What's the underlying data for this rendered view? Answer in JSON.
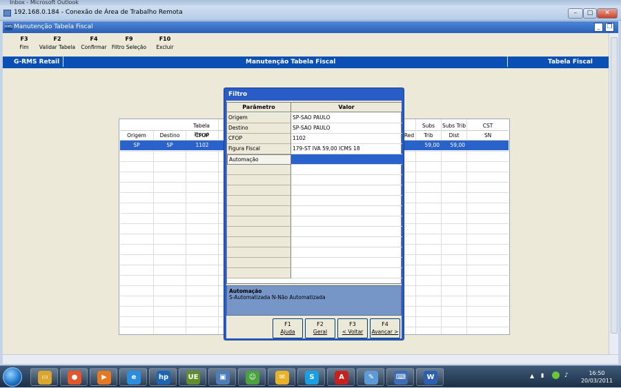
{
  "outlook_window": {
    "title": "Inbox - Microsoft Outlook"
  },
  "rdp_window": {
    "title": "192.168.0.184 - Conexão de Área de Trabalho Remota",
    "min": "–",
    "max": "□",
    "close": "✕"
  },
  "app_window": {
    "title": "Manutenção Tabela Fiscal",
    "icon_text": "RMS",
    "min": "_",
    "restore": "❐"
  },
  "function_keys": [
    {
      "key": "F3",
      "label": "Fim"
    },
    {
      "key": "F2",
      "label": "Validar Tabela"
    },
    {
      "key": "F4",
      "label": "Confirmar"
    },
    {
      "key": "F9",
      "label": "Filtro Seleção"
    },
    {
      "key": "F10",
      "label": "Excluir"
    }
  ],
  "header_bar": {
    "left": "G-RMS Retail",
    "center": "Manutenção Tabela Fiscal",
    "right": "Tabela Fiscal"
  },
  "background_grid": {
    "group_header": "Tabela Fiscal",
    "columns": [
      "Origem",
      "Destino",
      "CFOP"
    ],
    "right_columns": [
      {
        "top": "",
        "bottom": "Red"
      },
      {
        "top": "Subs",
        "bottom": "Trib"
      },
      {
        "top": "Subs Trib",
        "bottom": "Dist"
      },
      {
        "top": "CST",
        "bottom": "SN"
      }
    ],
    "selected_row": {
      "origem": "SP",
      "destino": "SP",
      "cfop": "1102",
      "subs_trib": "59,00",
      "subs_trib_dist": "59,00"
    }
  },
  "filter_dialog": {
    "title": "Filtro",
    "headers": {
      "param": "Parâmetro",
      "value": "Valor"
    },
    "rows": [
      {
        "param": "Origem",
        "value": "SP-SAO PAULO"
      },
      {
        "param": "Destino",
        "value": "SP-SAO PAULO"
      },
      {
        "param": "CFOP",
        "value": "1102"
      },
      {
        "param": "Figura Fiscal",
        "value": "179-ST IVA 59,00 ICMS 18"
      },
      {
        "param": "Automação",
        "value": ""
      }
    ],
    "description": {
      "title": "Automação",
      "text": "S-Automatizada N-Não Automatizada"
    },
    "buttons": [
      {
        "key": "F1",
        "label": "Ajuda"
      },
      {
        "key": "F2",
        "label": "Geral"
      },
      {
        "key": "F3",
        "label": "< Voltar"
      },
      {
        "key": "F4",
        "label": "Avançar >"
      }
    ]
  },
  "taskbar": {
    "apps": [
      {
        "icon": "explorer-folder-icon",
        "glyph": "▭",
        "color": "#d9a62e"
      },
      {
        "icon": "firefox-icon",
        "glyph": "●",
        "color": "#e2562a"
      },
      {
        "icon": "media-player-icon",
        "glyph": "▶",
        "color": "#e87722"
      },
      {
        "icon": "internet-explorer-icon",
        "glyph": "e",
        "color": "#2a8ee0"
      },
      {
        "icon": "hp-icon",
        "glyph": "hp",
        "color": "#1c64b4"
      },
      {
        "icon": "ultraedit-icon",
        "glyph": "UE",
        "color": "#5e8f2c"
      },
      {
        "icon": "remote-monitor-icon",
        "glyph": "▣",
        "color": "#4e7db8"
      },
      {
        "icon": "users-icon",
        "glyph": "☺",
        "color": "#4aa23c"
      },
      {
        "icon": "outlook-mail-icon",
        "glyph": "✉",
        "color": "#e8b22a"
      },
      {
        "icon": "skype-icon",
        "glyph": "S",
        "color": "#1aa0e0"
      },
      {
        "icon": "acrobat-icon",
        "glyph": "A",
        "color": "#c8201e"
      },
      {
        "icon": "paint-icon",
        "glyph": "✎",
        "color": "#5c9bd6"
      },
      {
        "icon": "remote-desktop-icon",
        "glyph": "⌨",
        "color": "#3d6db5"
      },
      {
        "icon": "word-icon",
        "glyph": "W",
        "color": "#2b5faf"
      }
    ],
    "clock": {
      "time": "16:50",
      "date": "20/03/2011"
    }
  }
}
